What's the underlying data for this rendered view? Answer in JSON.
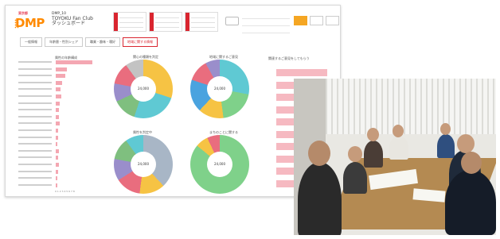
{
  "dashboard": {
    "logo_sub": "東京都",
    "logo_main": "DMP",
    "title_line1": "DMP_10",
    "title_line2": "TOYOKU Fan Club",
    "title_line3": "ダッシュボード",
    "tabs": [
      "一般情報",
      "年齢層・性別シェア",
      "職業・趣味・嗜好",
      "地域に関する情報"
    ],
    "active_tab": 3,
    "left_chart_title": "属性の年齢構成",
    "left_bar_values": [
      1.0,
      0.3,
      0.26,
      0.18,
      0.12,
      0.16,
      0.1,
      0.09,
      0.08,
      0.11,
      0.07,
      0.06,
      0.05,
      0.09,
      0.07,
      0.08,
      0.06,
      0.05,
      0.04
    ],
    "axis_ticks": "0 1 2 3 4 5 6 7 8",
    "pies": [
      {
        "title": "関心の種類を判定",
        "center": "24,000"
      },
      {
        "title": "地域に関するご意見",
        "center": "24,000"
      },
      {
        "title": "属性を判定中",
        "center": "24,000"
      },
      {
        "title": "まちのことに関する",
        "center": "24,000"
      }
    ],
    "right_chart_title": "関連するご意見をしてもらう",
    "right_bar_values": [
      0.82,
      0.7,
      0.62,
      0.75,
      0.68,
      0.58,
      0.85,
      0.72,
      0.64,
      0.55
    ]
  },
  "colors": {
    "accent_red": "#d9252f",
    "logo_orange": "#ff8a00",
    "bar_pink": "#f4a7b2"
  }
}
